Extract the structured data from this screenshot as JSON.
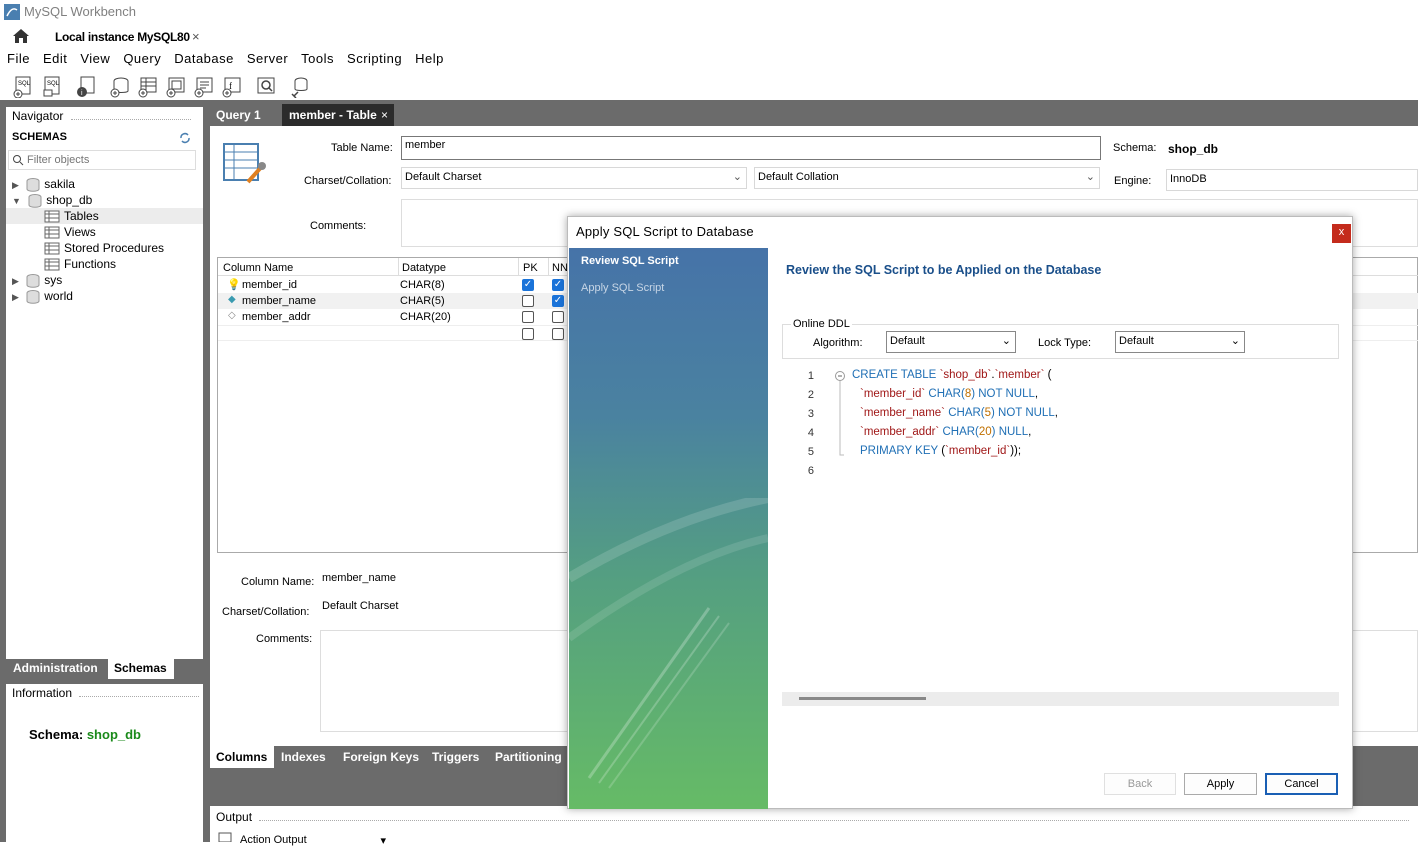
{
  "app": {
    "title": "MySQL Workbench",
    "connection_tab": "Local instance MySQL80"
  },
  "menu": [
    "File",
    "Edit",
    "View",
    "Query",
    "Database",
    "Server",
    "Tools",
    "Scripting",
    "Help"
  ],
  "navigator": {
    "header": "Navigator",
    "schemas_label": "SCHEMAS",
    "filter_placeholder": "Filter objects",
    "tree": [
      {
        "label": "sakila",
        "expanded": false
      },
      {
        "label": "shop_db",
        "expanded": true,
        "children": [
          "Tables",
          "Views",
          "Stored Procedures",
          "Functions"
        ]
      },
      {
        "label": "sys",
        "expanded": false
      },
      {
        "label": "world",
        "expanded": false
      }
    ],
    "tabs": [
      "Administration",
      "Schemas"
    ]
  },
  "information": {
    "header": "Information",
    "schema_label": "Schema:",
    "schema_value": "shop_db"
  },
  "editor_tabs": [
    "Query 1",
    "member - Table"
  ],
  "table_editor": {
    "table_name_label": "Table Name:",
    "table_name": "member",
    "schema_label": "Schema:",
    "schema_value": "shop_db",
    "charset_label": "Charset/Collation:",
    "charset": "Default Charset",
    "collation": "Default Collation",
    "engine_label": "Engine:",
    "engine": "InnoDB",
    "comments_label": "Comments:",
    "grid_headers": [
      "Column Name",
      "Datatype",
      "PK",
      "NN"
    ],
    "columns": [
      {
        "name": "member_id",
        "type": "CHAR(8)",
        "pk": true,
        "nn": true
      },
      {
        "name": "member_name",
        "type": "CHAR(5)",
        "pk": false,
        "nn": true
      },
      {
        "name": "member_addr",
        "type": "CHAR(20)",
        "pk": false,
        "nn": false
      }
    ],
    "detail": {
      "column_name_label": "Column Name:",
      "column_name": "member_name",
      "charset_label": "Charset/Collation:",
      "charset": "Default Charset",
      "comments_label": "Comments:"
    },
    "bottom_tabs": [
      "Columns",
      "Indexes",
      "Foreign Keys",
      "Triggers",
      "Partitioning"
    ]
  },
  "output": {
    "header": "Output",
    "selector": "Action Output"
  },
  "dialog": {
    "title": "Apply SQL Script to Database",
    "close": "x",
    "steps": [
      "Review SQL Script",
      "Apply SQL Script"
    ],
    "heading": "Review the SQL Script to be Applied on the Database",
    "online_ddl_label": "Online DDL",
    "algorithm_label": "Algorithm:",
    "algorithm": "Default",
    "lock_label": "Lock Type:",
    "lock": "Default",
    "line_numbers": [
      "1",
      "2",
      "3",
      "4",
      "5",
      "6"
    ],
    "buttons": {
      "back": "Back",
      "apply": "Apply",
      "cancel": "Cancel"
    }
  },
  "colors": {
    "accent": "#1f6fb5",
    "schema_green": "#1a8a1a",
    "panel_gray": "#6b6b6b"
  }
}
